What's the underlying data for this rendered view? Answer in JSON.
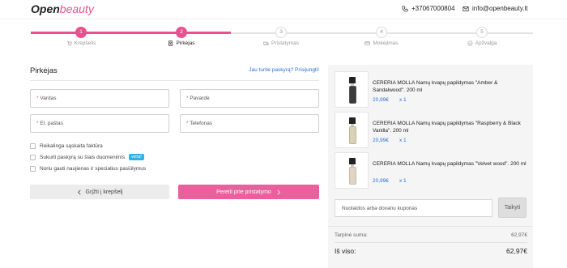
{
  "header": {
    "logo_bold": "Open",
    "logo_light": "beauty",
    "phone": "+37067000804",
    "email": "info@openbeauty.lt"
  },
  "stepper": {
    "steps": [
      {
        "num": "1",
        "label": "Krepšelis",
        "state": "done",
        "icon": "cart-icon"
      },
      {
        "num": "2",
        "label": "Pirkėjas",
        "state": "current",
        "icon": "user-icon"
      },
      {
        "num": "3",
        "label": "Pristatymas",
        "state": "pending",
        "icon": "truck-icon"
      },
      {
        "num": "4",
        "label": "Mokėjimas",
        "state": "pending",
        "icon": "card-icon"
      },
      {
        "num": "5",
        "label": "Apžvalga",
        "state": "pending",
        "icon": "check-circle-icon"
      }
    ],
    "accent": "#e8508f"
  },
  "buyer": {
    "title": "Pirkėjas",
    "login_link": "Jau turite paskyrą? Prisijungti!",
    "fields": {
      "first_name": "Vardas",
      "last_name": "Pavardė",
      "email": "El. paštas",
      "phone": "Telefonas"
    },
    "checkboxes": {
      "invoice": "Reikalinga sąskaita faktūra",
      "create_account": "Sukurti paskyrą su šiais duomenimis",
      "create_account_badge": "verta!",
      "newsletter": "Noriu gauti naujienas ir specialius pasiūlymus"
    },
    "back_button": "Grįžti į krepšelį",
    "next_button": "Pereiti prie pristatymo"
  },
  "cart": {
    "items": [
      {
        "name": "CERERIA MOLLA Namų kvapų papildymas \"Amber & Sandalwood\". 200 ml",
        "price": "20,99€",
        "qty": "x 1",
        "liquid_color": "#3a3a3a"
      },
      {
        "name": "CERERIA MOLLA Namų kvapų papildymas \"Raspberry & Black Vanilla\". 200 ml",
        "price": "20,99€",
        "qty": "x 1",
        "liquid_color": "#d9d2b6"
      },
      {
        "name": "CERERIA MOLLA Namų kvapų papildymas \"Velvet wood\". 200 ml",
        "price": "20,99€",
        "qty": "x 1",
        "liquid_color": "#ddd6c2"
      }
    ],
    "coupon_placeholder": "Nuolaidos arba dovanu kuponas",
    "apply_button": "Taikyti",
    "subtotal_label": "Tarpinė suma:",
    "subtotal_value": "62,97€",
    "total_label": "Iš viso:",
    "total_value": "62,97€"
  }
}
